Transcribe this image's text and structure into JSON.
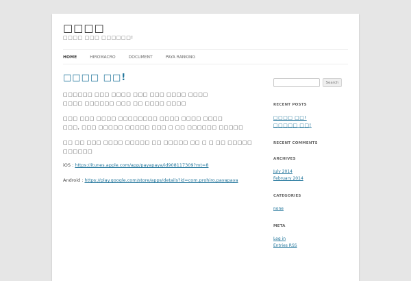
{
  "site": {
    "title": "□□□□",
    "description": "□□□□ □□□ □□□□□□!"
  },
  "nav": {
    "items": [
      "HOME",
      "HIROMACRO",
      "DOCUMENT",
      "PAYA RANKING"
    ]
  },
  "post": {
    "title": "□□□□ □□!",
    "paragraphs": [
      "□□□□□□ □□□ □□□□ □□□ □□□ □□□□ □□□□\n□□□□ □□□□□□ □□□ □□ □□□□ □□□□",
      "□□□ □□□ □□□□ □□□□□□□□ □□□□ □□□□ □□□□\n□□□, □□□ □□□□□ □□□□□ □□□ □ □□ □□□□□□ □□□□□",
      "□□ □□ □□□ □□□□ □□□□□ □□ □□□□□ □□ □ □ □□ □□□□□ □□□□□□"
    ],
    "ios_label": "iOS : ",
    "ios_url": "https://itunes.apple.com/app/payapaya/id908117309?mt=8",
    "android_label": "Android : ",
    "android_url": "https://play.google.com/store/apps/details?id=com.prohiro.payapaya"
  },
  "sidebar": {
    "search_button": "Search",
    "search_placeholder": "",
    "recent_posts_title": "RECENT POSTS",
    "recent_posts": [
      "□□□□ □□!",
      "□□□□□ □□!"
    ],
    "recent_comments_title": "RECENT COMMENTS",
    "archives_title": "ARCHIVES",
    "archives": [
      "July 2014",
      "February 2014"
    ],
    "categories_title": "CATEGORIES",
    "categories": [
      "none"
    ],
    "meta_title": "META",
    "meta": [
      "Log in",
      "Entries RSS"
    ]
  },
  "colors": {
    "background": "#e6e6e6",
    "link": "#21759b",
    "text": "#444444"
  }
}
